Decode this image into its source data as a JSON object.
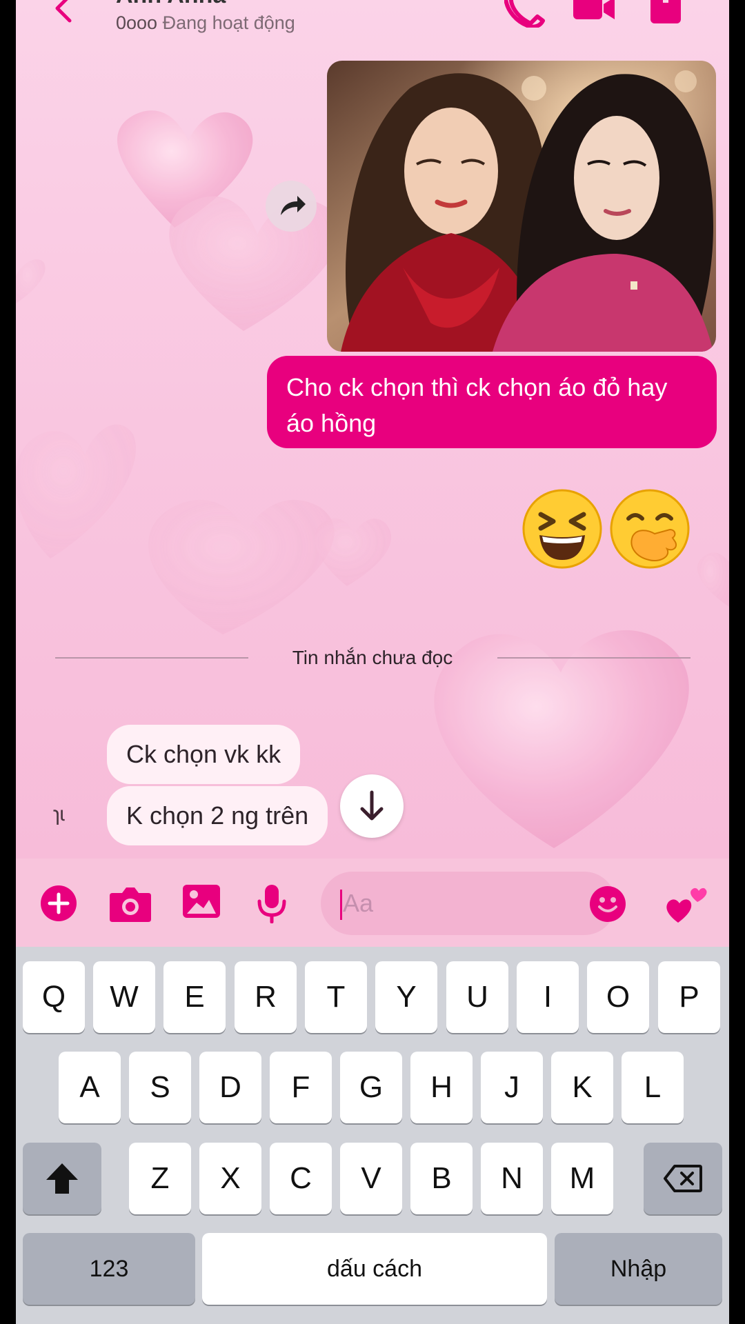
{
  "header": {
    "contact_name": "Anh Anna",
    "status": "Đang hoạt động",
    "status_prefix": "0ooo"
  },
  "messages": {
    "sent_text": "Cho ck chọn thì ck chọn áo đỏ hay áo hồng",
    "emojis": [
      "😆",
      "🤭"
    ],
    "divider": "Tin nhắn chưa đọc",
    "received": [
      "Ck chọn vk kk",
      "K chọn 2 ng trên"
    ],
    "avatar_stub": "ɿɩ"
  },
  "composer": {
    "placeholder": "Aa",
    "like_emoji": "💕"
  },
  "keyboard": {
    "row1": [
      "Q",
      "W",
      "E",
      "R",
      "T",
      "Y",
      "U",
      "I",
      "O",
      "P"
    ],
    "row2": [
      "A",
      "S",
      "D",
      "F",
      "G",
      "H",
      "J",
      "K",
      "L"
    ],
    "row3": [
      "Z",
      "X",
      "C",
      "V",
      "B",
      "N",
      "M"
    ],
    "numbers_label": "123",
    "space_label": "dấu cách",
    "enter_label": "Nhập"
  },
  "colors": {
    "accent": "#e8007e",
    "chat_bg": "#f9c6e0",
    "keyboard_bg": "#d1d3d9"
  }
}
